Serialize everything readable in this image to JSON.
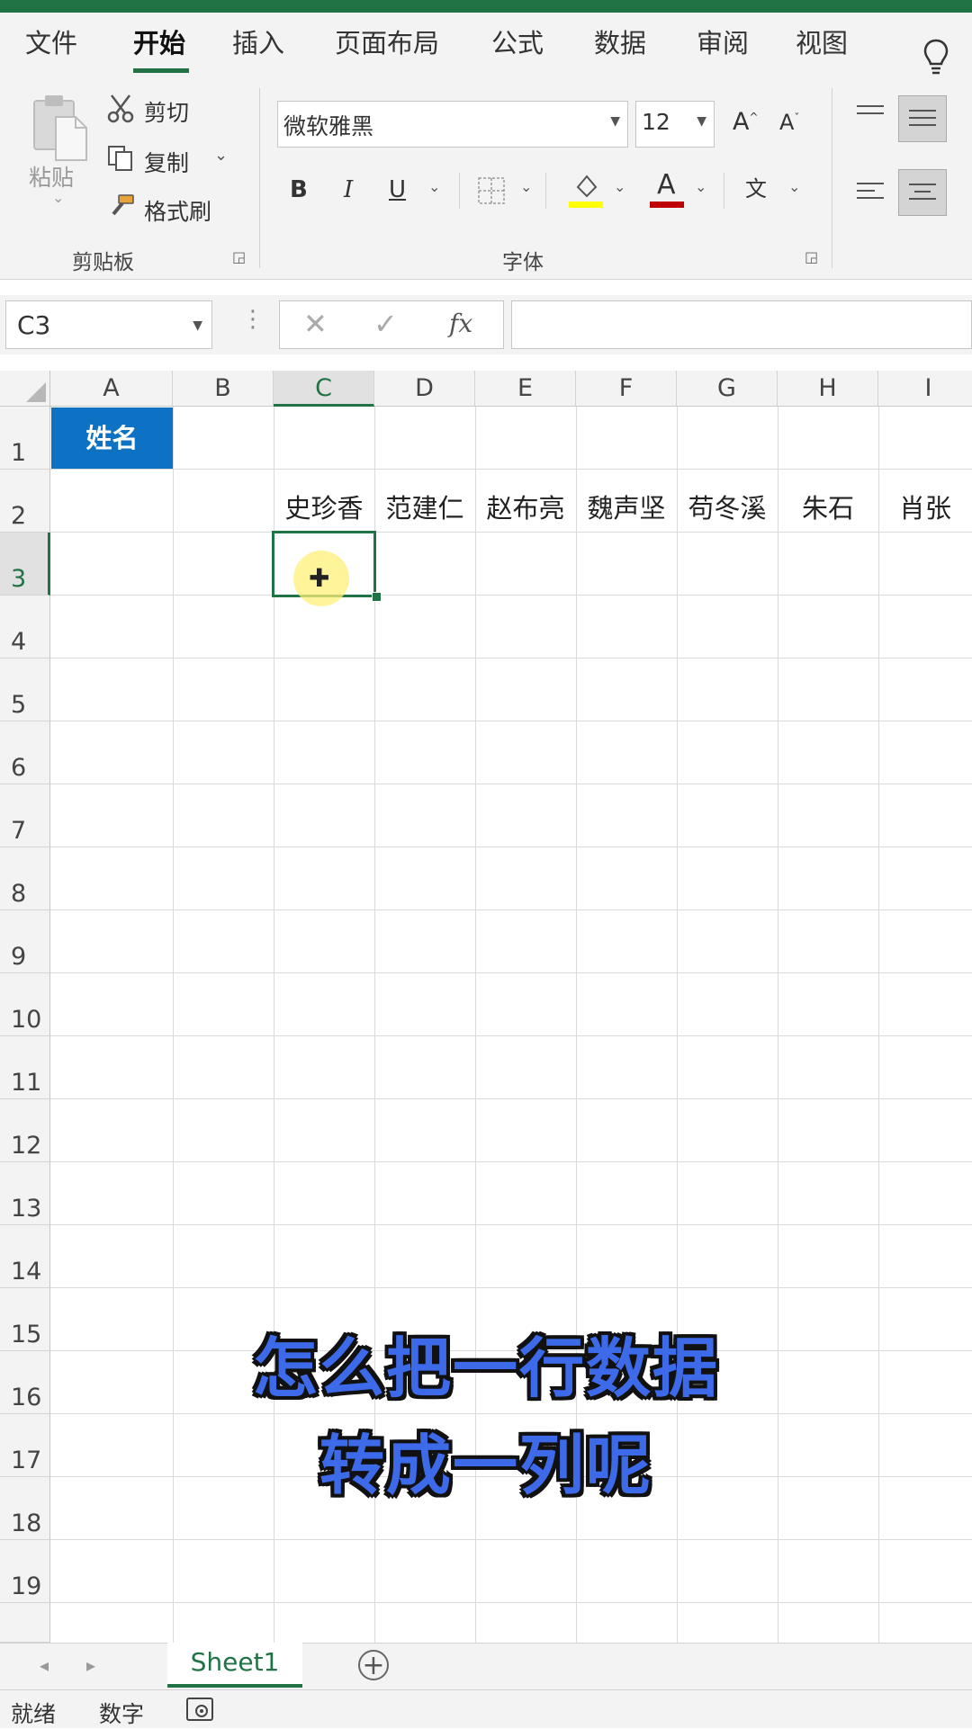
{
  "menu": {
    "tabs": [
      "文件",
      "开始",
      "插入",
      "页面布局",
      "公式",
      "数据",
      "审阅",
      "视图"
    ],
    "active_tab": "开始"
  },
  "clipboard": {
    "paste_label": "粘贴",
    "cut_label": "剪切",
    "copy_label": "复制",
    "format_painter_label": "格式刷",
    "group_label": "剪贴板"
  },
  "font": {
    "font_name": "微软雅黑",
    "font_size": "12",
    "bold_label": "B",
    "italic_label": "I",
    "underline_label": "U",
    "font_color_label": "A",
    "group_label": "字体",
    "fill_color": "#ffff00",
    "text_color": "#c00000"
  },
  "formula_bar": {
    "name_box": "C3",
    "fx_label": "fx",
    "value": ""
  },
  "grid": {
    "columns": [
      "A",
      "B",
      "C",
      "D",
      "E",
      "F",
      "G",
      "H",
      "I"
    ],
    "rows": [
      "1",
      "2",
      "3",
      "4",
      "5",
      "6",
      "7",
      "8",
      "9",
      "10",
      "11",
      "12",
      "13",
      "14",
      "15",
      "16",
      "17",
      "18",
      "19"
    ],
    "selected_cell": "C3",
    "header_cell": {
      "ref": "A1",
      "text": "姓名",
      "fill": "#0e72c4"
    },
    "row2_names": [
      "史珍香",
      "范建仁",
      "赵布亮",
      "魏声坚",
      "苟冬溪",
      "朱石",
      "肖张"
    ]
  },
  "overlay": {
    "line1": "怎么把一行数据",
    "line2": "转成一列呢"
  },
  "sheets": {
    "active": "Sheet1",
    "add_label": "+"
  },
  "status": {
    "ready": "就绪",
    "mode": "数字"
  },
  "colors": {
    "accent": "#217346"
  }
}
